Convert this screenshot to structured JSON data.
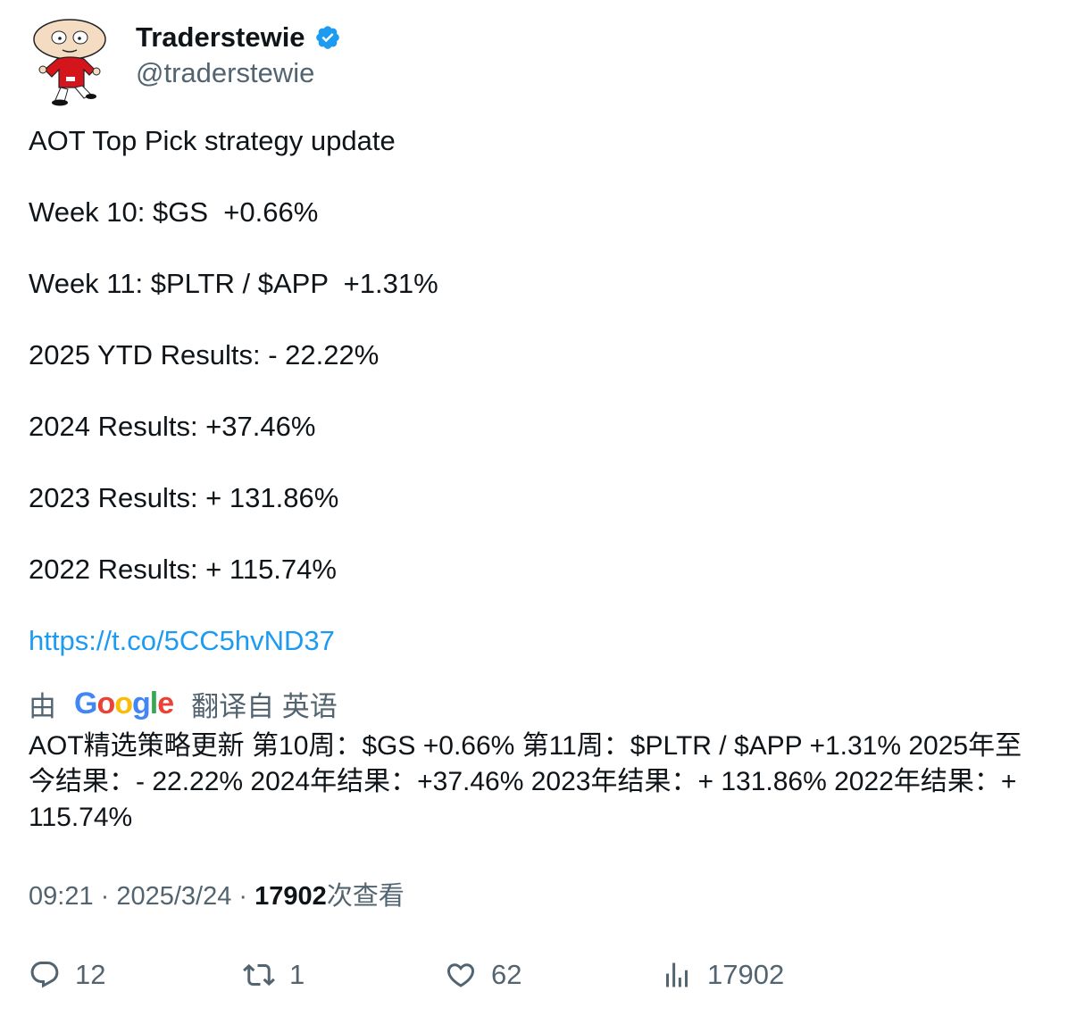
{
  "user": {
    "display_name": "Traderstewie",
    "handle": "@traderstewie",
    "verified": true,
    "verified_color": "#1d9bf0"
  },
  "tweet": {
    "lines": [
      "AOT Top Pick strategy update",
      "Week 10: $GS  +0.66%",
      "Week 11: $PLTR / $APP  +1.31%",
      "2025 YTD Results: - 22.22%",
      "2024 Results: +37.46%",
      "2023 Results: + 131.86%",
      "2022 Results: + 115.74%"
    ],
    "link": "https://t.co/5CC5hvND37",
    "link_color": "#1d9bf0"
  },
  "translation": {
    "prefix": "由",
    "provider": "Google",
    "suffix": "翻译自 英语",
    "text": "AOT精选策略更新 第10周：$GS +0.66% 第11周：$PLTR / $APP +1.31% 2025年至今结果：- 22.22% 2024年结果：+37.46% 2023年结果：+ 131.86% 2022年结果：+ 115.74%"
  },
  "meta": {
    "time": "09:21",
    "date": "2025/3/24",
    "views_count": "17902",
    "views_label": "次查看"
  },
  "actions": {
    "replies": "12",
    "retweets": "1",
    "likes": "62",
    "views": "17902"
  },
  "icons": {
    "reply": "reply-icon",
    "retweet": "retweet-icon",
    "like": "heart-icon",
    "views": "analytics-icon",
    "verified": "verified-badge-icon"
  }
}
